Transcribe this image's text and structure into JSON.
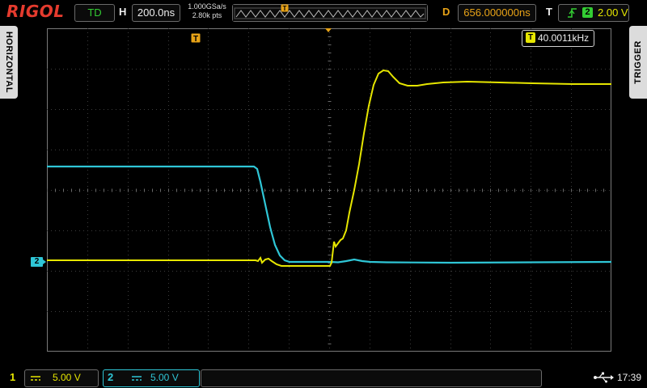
{
  "header": {
    "brand": "RIGOL",
    "run_status": "TD",
    "horizontal_label": "H",
    "timebase": "200.0ns",
    "sample_rate": "1.000GSa/s",
    "memory_depth": "2.80k pts",
    "delay_label": "D",
    "delay": "656.000000ns",
    "trigger_label": "T",
    "trigger_source": "2",
    "trigger_level": "2.00 V"
  },
  "side": {
    "left_tab": "HORIZONTAL",
    "right_tab": "TRIGGER"
  },
  "measurement": {
    "frequency": "40.0011kHz",
    "icon": "trigger-T-icon"
  },
  "channels": [
    {
      "number": "1",
      "coupling_icon": "dc-coupling-icon",
      "scale": "5.00 V",
      "color": "#e6e600"
    },
    {
      "number": "2",
      "coupling_icon": "dc-coupling-icon",
      "scale": "5.00 V",
      "color": "#2fc6d6"
    }
  ],
  "screen": {
    "ch2_ground_marker": "2",
    "grid_divisions": {
      "horizontal": 14,
      "vertical": 8
    }
  },
  "status": {
    "usb_icon": "usb-icon",
    "clock": "17:39"
  },
  "colors": {
    "brand": "#e53b2e",
    "ch1": "#e6e600",
    "ch2": "#2fc6d6",
    "delay": "#e8a317",
    "run_status": "#33cc33"
  }
}
